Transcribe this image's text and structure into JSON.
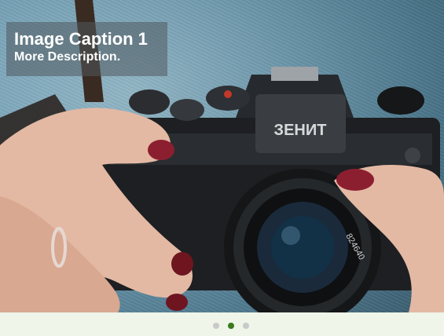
{
  "slider": {
    "caption": {
      "title": "Image Caption 1",
      "description": "More Description."
    },
    "slide_image": {
      "subject": "hands holding camera",
      "camera_brand": "ЗЕНИТ",
      "lens_marking": "824640"
    },
    "pagination": {
      "count": 3,
      "active_index": 1,
      "active_color": "#3b7a1f",
      "inactive_color": "#c9c9c9"
    }
  }
}
